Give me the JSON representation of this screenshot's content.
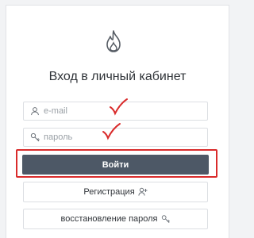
{
  "login": {
    "title": "Вход в личный кабинет",
    "email_placeholder": "e-mail",
    "password_placeholder": "пароль",
    "login_button": "Войти",
    "register_button": "Регистрация",
    "restore_button": "восстановление пароля"
  },
  "icons": {
    "logo": "flame-icon",
    "email": "user-icon",
    "password": "key-icon",
    "register": "user-plus-icon",
    "restore": "key-icon"
  },
  "annotations": {
    "marks": [
      "checkmark",
      "checkmark"
    ],
    "highlight_color": "#d92b2b"
  },
  "colors": {
    "button_bg": "#4d5866",
    "button_text": "#ffffff",
    "accent_mark": "#d92b2b"
  }
}
